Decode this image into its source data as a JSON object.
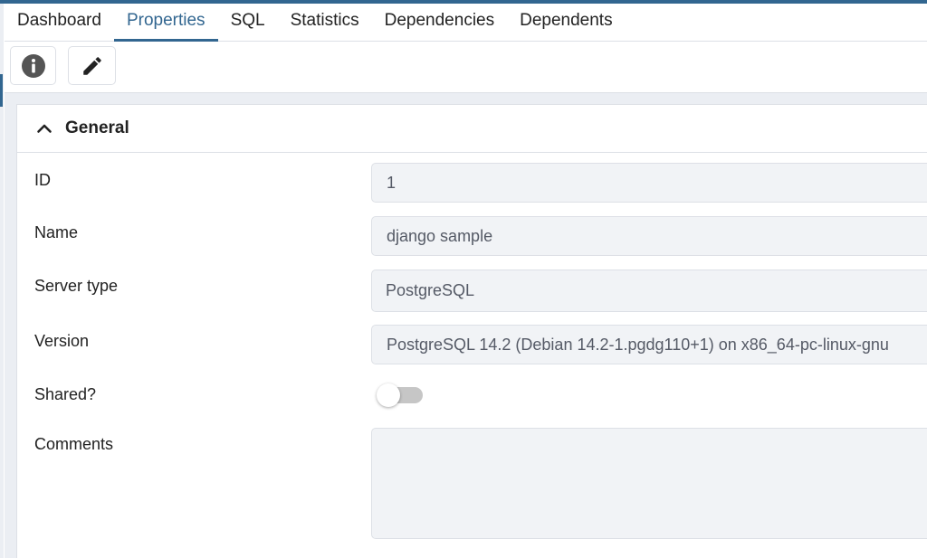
{
  "tabs": [
    {
      "label": "Dashboard",
      "active": false
    },
    {
      "label": "Properties",
      "active": true
    },
    {
      "label": "SQL",
      "active": false
    },
    {
      "label": "Statistics",
      "active": false
    },
    {
      "label": "Dependencies",
      "active": false
    },
    {
      "label": "Dependents",
      "active": false
    }
  ],
  "toolbar": {
    "info_icon": "info-circle-icon",
    "edit_icon": "pencil-icon"
  },
  "section": {
    "title": "General",
    "expanded": true,
    "icon": "chevron-up-icon"
  },
  "fields": {
    "id": {
      "label": "ID",
      "value": "1"
    },
    "name": {
      "label": "Name",
      "value": "django sample"
    },
    "server_type": {
      "label": "Server type",
      "value": "PostgreSQL"
    },
    "version": {
      "label": "Version",
      "value": "PostgreSQL 14.2 (Debian 14.2-1.pgdg110+1) on x86_64-pc-linux-gnu"
    },
    "shared": {
      "label": "Shared?",
      "value": false
    },
    "comments": {
      "label": "Comments",
      "value": ""
    }
  },
  "colors": {
    "accent": "#326690",
    "input_bg": "#f1f3f6",
    "page_bg": "#ebeef3"
  }
}
